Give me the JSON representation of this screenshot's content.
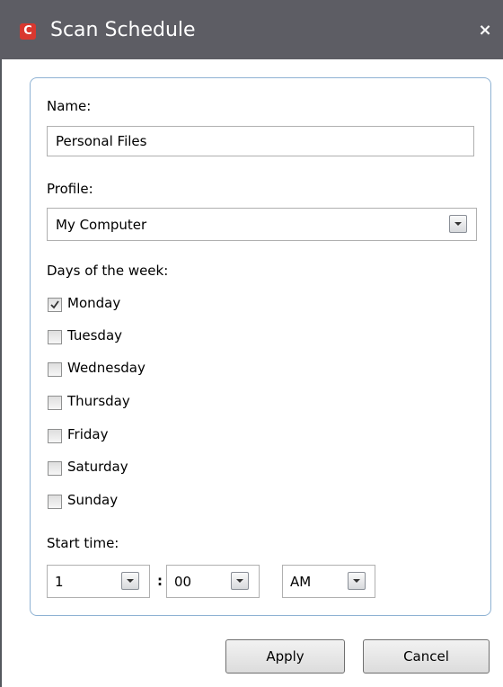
{
  "window": {
    "title": "Scan Schedule",
    "close_glyph": "×",
    "logo_letter": "C",
    "accent_color": "#d9382f",
    "titlebar_color": "#5d5d64"
  },
  "form": {
    "name_label": "Name:",
    "name_value": "Personal Files",
    "profile_label": "Profile:",
    "profile_value": "My Computer",
    "days_label": "Days of the week:",
    "days": [
      {
        "label": "Monday",
        "checked": true
      },
      {
        "label": "Tuesday",
        "checked": false
      },
      {
        "label": "Wednesday",
        "checked": false
      },
      {
        "label": "Thursday",
        "checked": false
      },
      {
        "label": "Friday",
        "checked": false
      },
      {
        "label": "Saturday",
        "checked": false
      },
      {
        "label": "Sunday",
        "checked": false
      }
    ],
    "start_time_label": "Start time:",
    "hour": "1",
    "separator": ":",
    "minute": "00",
    "ampm": "AM"
  },
  "buttons": {
    "apply": "Apply",
    "cancel": "Cancel"
  }
}
